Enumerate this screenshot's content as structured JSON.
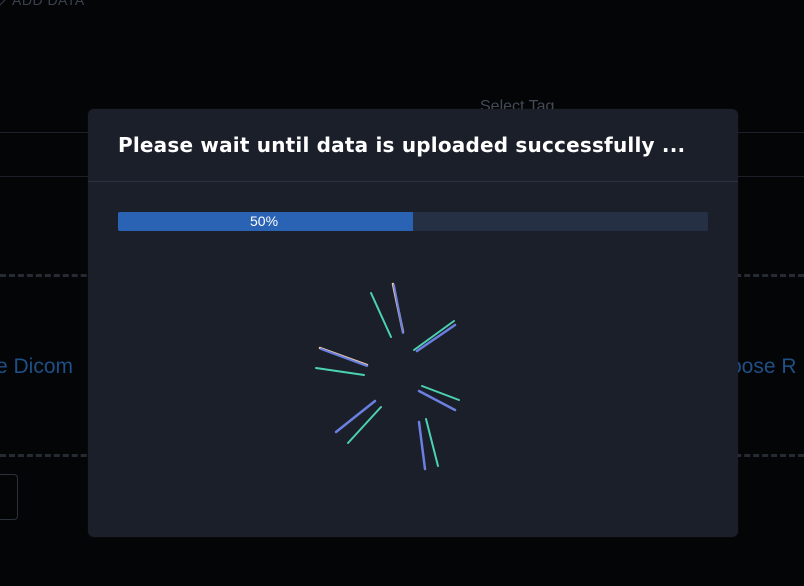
{
  "background": {
    "breadcrumb_label": "ADD DATA",
    "select_tag_label": "Select Tag",
    "left_fragment": "e Dicom",
    "right_fragment": "oose R"
  },
  "modal": {
    "title": "Please wait until data is uploaded successfully ...",
    "progress": {
      "value": 0.5,
      "label": "50%",
      "fill_color": "#2a63b3",
      "track_color": "#253044"
    },
    "spinner": {
      "icon": "loading-spinner-icon",
      "colors": [
        "#4dd2b0",
        "#6b7fe0",
        "#e8c9a0"
      ]
    }
  }
}
